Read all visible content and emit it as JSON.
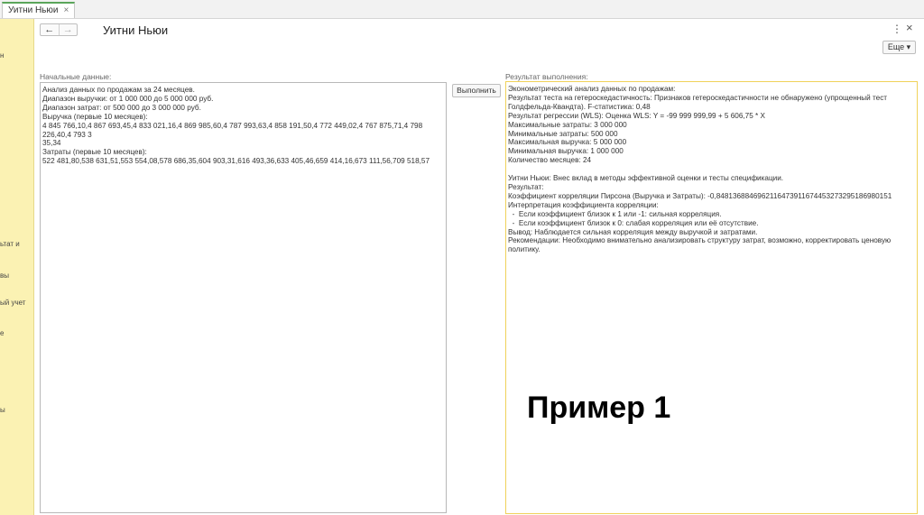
{
  "tab": {
    "label": "Уитни Ньюи",
    "close": "×"
  },
  "sidebar": {
    "items": [
      {
        "label": "н"
      },
      {
        "label": "ьтат и"
      },
      {
        "label": "вы"
      },
      {
        "label": "ый учет"
      },
      {
        "label": "е"
      },
      {
        "label": "ы"
      }
    ]
  },
  "header": {
    "back": "←",
    "forward": "→",
    "title": "Уитни Ньюи",
    "menu": "⋮",
    "close": "×",
    "more": "Еще ▾"
  },
  "form": {
    "input_label": "Начальные данные:",
    "input_text": "Анализ данных по продажам за 24 месяцев.\nДиапазон выручки: от 1 000 000 до 5 000 000 руб.\nДиапазон затрат: от 500 000 до 3 000 000 руб.\nВыручка (первые 10 месяцев):\n4 845 766,10,4 867 693,45,4 833 021,16,4 869 985,60,4 787 993,63,4 858 191,50,4 772 449,02,4 767 875,71,4 798 226,40,4 793 3\n35,34\nЗатраты (первые 10 месяцев):\n522 481,80,538 631,51,553 554,08,578 686,35,604 903,31,616 493,36,633 405,46,659 414,16,673 111,56,709 518,57",
    "run_button": "Выполнить",
    "result_label": "Результат выполнения:",
    "result_text": "Эконометрический анализ данных по продажам:\nРезультат теста на гетероскедастичность: Признаков гетероскедастичности не обнаружено (упрощенный тест\nГолдфельда-Квандта). F-статистика: 0,48\nРезультат регрессии (WLS): Оценка WLS: Y = -99 999 999,99 + 5 606,75 * X\nМаксимальные затраты: 3 000 000\nМинимальные затраты: 500 000\nМаксимальная выручка: 5 000 000\nМинимальная выручка: 1 000 000\nКоличество месяцев: 24\n\nУитни Ньюи: Внес вклад в методы эффективной оценки и тесты спецификации.\nРезультат:\nКоэффициент корреляции Пирсона (Выручка и Затраты): -0,848136884696211647391167445327329518698015​1\nИнтерпретация коэффициента корреляции:\n  -  Если коэффициент близок к 1 или -1: сильная корреляция.\n  -  Если коэффициент близок к 0: слабая корреляция или её отсутствие.\nВывод: Наблюдается сильная корреляция между выручкой и затратами.\nРекомендации: Необходимо внимательно анализировать структуру затрат, возможно, корректировать ценовую политику."
  },
  "overlay_text": "Пример 1",
  "colors": {
    "sidebar": "#fbf2b3",
    "result_border": "#f0d25a",
    "active_tab": "#5aa55a"
  }
}
